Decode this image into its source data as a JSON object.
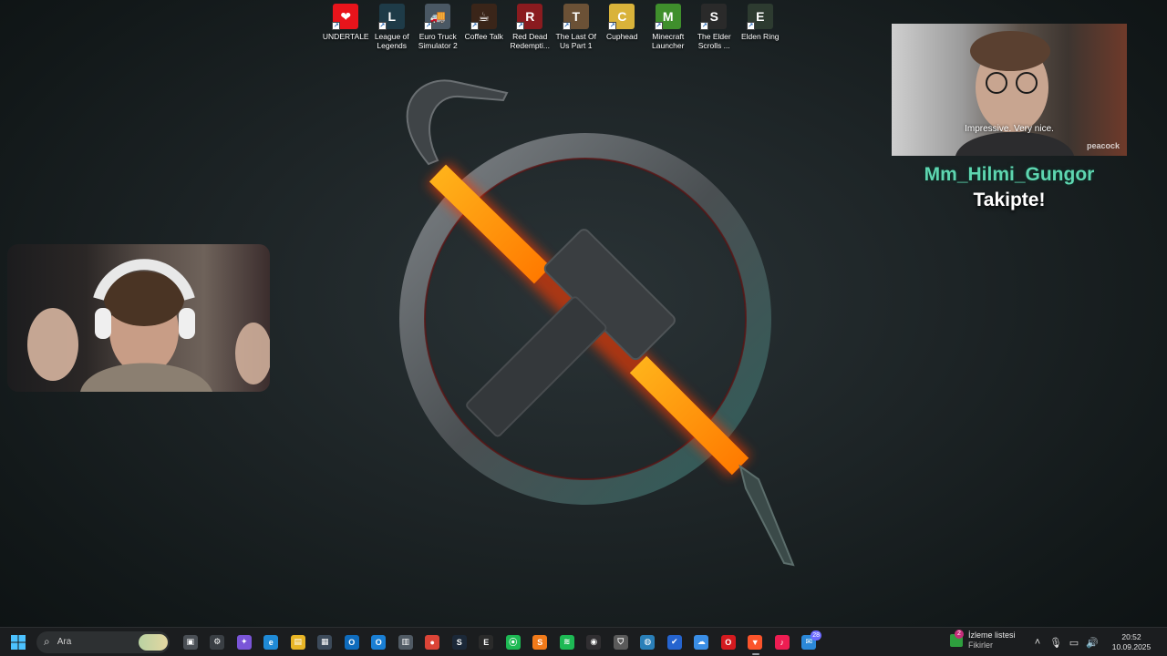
{
  "desktop_icons": [
    {
      "label": "UNDERTALE",
      "icon": "undertale-heart-icon",
      "color": "#e8141b",
      "glyph": "❤"
    },
    {
      "label": "League of\nLegends",
      "icon": "league-of-legends-icon",
      "color": "#1e3b48",
      "glyph": "L"
    },
    {
      "label": "Euro Truck\nSimulator 2",
      "icon": "euro-truck-icon",
      "color": "#4a5864",
      "glyph": "🚚"
    },
    {
      "label": "Coffee Talk",
      "icon": "coffee-talk-icon",
      "color": "#3a2519",
      "glyph": "☕"
    },
    {
      "label": "Red Dead\nRedempti...",
      "icon": "red-dead-icon",
      "color": "#8a1b1f",
      "glyph": "R"
    },
    {
      "label": "The Last Of\nUs Part 1",
      "icon": "last-of-us-icon",
      "color": "#6b5136",
      "glyph": "T"
    },
    {
      "label": "Cuphead",
      "icon": "cuphead-icon",
      "color": "#d9b33a",
      "glyph": "C"
    },
    {
      "label": "Minecraft\nLauncher",
      "icon": "minecraft-icon",
      "color": "#3f8f2c",
      "glyph": "M"
    },
    {
      "label": "The Elder\nScrolls ...",
      "icon": "elder-scrolls-icon",
      "color": "#2a2a2a",
      "glyph": "S"
    },
    {
      "label": "Elden Ring",
      "icon": "elden-ring-icon",
      "color": "#2d3b30",
      "glyph": "E"
    }
  ],
  "follow_alert": {
    "gif_subtitle": "Impressive. Very nice.",
    "gif_watermark": "peacock",
    "username": "Mm_Hilmi_Gungor",
    "message": "Takipte!"
  },
  "taskbar": {
    "search_placeholder": "Ara",
    "apps": [
      {
        "name": "task-view",
        "icon": "task-view-icon",
        "color": "#4a4f55",
        "glyph": "▣"
      },
      {
        "name": "copilot-settings",
        "icon": "settings-gear-icon",
        "color": "#3a3f44",
        "glyph": "⚙",
        "badge": ""
      },
      {
        "name": "copilot",
        "icon": "copilot-icon",
        "color": "#7a55d8",
        "glyph": "✦"
      },
      {
        "name": "edge",
        "icon": "edge-browser-icon",
        "color": "#1f8ad6",
        "glyph": "e"
      },
      {
        "name": "file-explorer",
        "icon": "folder-icon",
        "color": "#e8b526",
        "glyph": "▤"
      },
      {
        "name": "store",
        "icon": "store-icon",
        "color": "#3c4a5a",
        "glyph": "▦"
      },
      {
        "name": "outlook",
        "icon": "outlook-icon",
        "color": "#0f6cbd",
        "glyph": "O"
      },
      {
        "name": "outlook-new",
        "icon": "outlook-new-icon",
        "color": "#1a7fd4",
        "glyph": "O"
      },
      {
        "name": "calculator",
        "icon": "calculator-icon",
        "color": "#505a64",
        "glyph": "▥"
      },
      {
        "name": "chrome",
        "icon": "chrome-icon",
        "color": "#db4437",
        "glyph": "●"
      },
      {
        "name": "steam",
        "icon": "steam-icon",
        "color": "#1b2838",
        "glyph": "S"
      },
      {
        "name": "epic",
        "icon": "epic-games-icon",
        "color": "#2a2a2a",
        "glyph": "E"
      },
      {
        "name": "spotify-green",
        "icon": "xbox-icon",
        "color": "#1db954",
        "glyph": "⦿"
      },
      {
        "name": "sublime",
        "icon": "sublime-icon",
        "color": "#f07a1a",
        "glyph": "S"
      },
      {
        "name": "spotify",
        "icon": "spotify-icon",
        "color": "#1db954",
        "glyph": "≋"
      },
      {
        "name": "obs",
        "icon": "obs-icon",
        "color": "#302e31",
        "glyph": "◉"
      },
      {
        "name": "vpn",
        "icon": "shield-icon",
        "color": "#5a5a5a",
        "glyph": "⛉"
      },
      {
        "name": "globe",
        "icon": "globe-icon",
        "color": "#2a7fb8",
        "glyph": "◍"
      },
      {
        "name": "todo",
        "icon": "checkmark-icon",
        "color": "#2564cf",
        "glyph": "✔"
      },
      {
        "name": "weather",
        "icon": "cloud-icon",
        "color": "#3a8ee6",
        "glyph": "☁"
      },
      {
        "name": "opera",
        "icon": "opera-icon",
        "color": "#d41a1f",
        "glyph": "O"
      },
      {
        "name": "brave",
        "icon": "brave-icon",
        "color": "#fb542b",
        "glyph": "▼",
        "active": true
      },
      {
        "name": "tiktok",
        "icon": "tiktok-icon",
        "color": "#ee1d52",
        "glyph": "♪"
      },
      {
        "name": "messages",
        "icon": "message-icon",
        "color": "#2b88d8",
        "glyph": "✉",
        "badge": "28"
      }
    ],
    "widget": {
      "title": "İzleme listesi",
      "subtitle": "Fikirler",
      "badge": "2"
    },
    "tray_icons": [
      {
        "icon": "chevron-up-icon",
        "glyph": "˄"
      },
      {
        "icon": "microphone-icon",
        "glyph": "🎙"
      },
      {
        "icon": "display-icon",
        "glyph": "▭"
      },
      {
        "icon": "volume-icon",
        "glyph": "🔊"
      }
    ],
    "time": "20:52",
    "date": "10.09.2025"
  }
}
